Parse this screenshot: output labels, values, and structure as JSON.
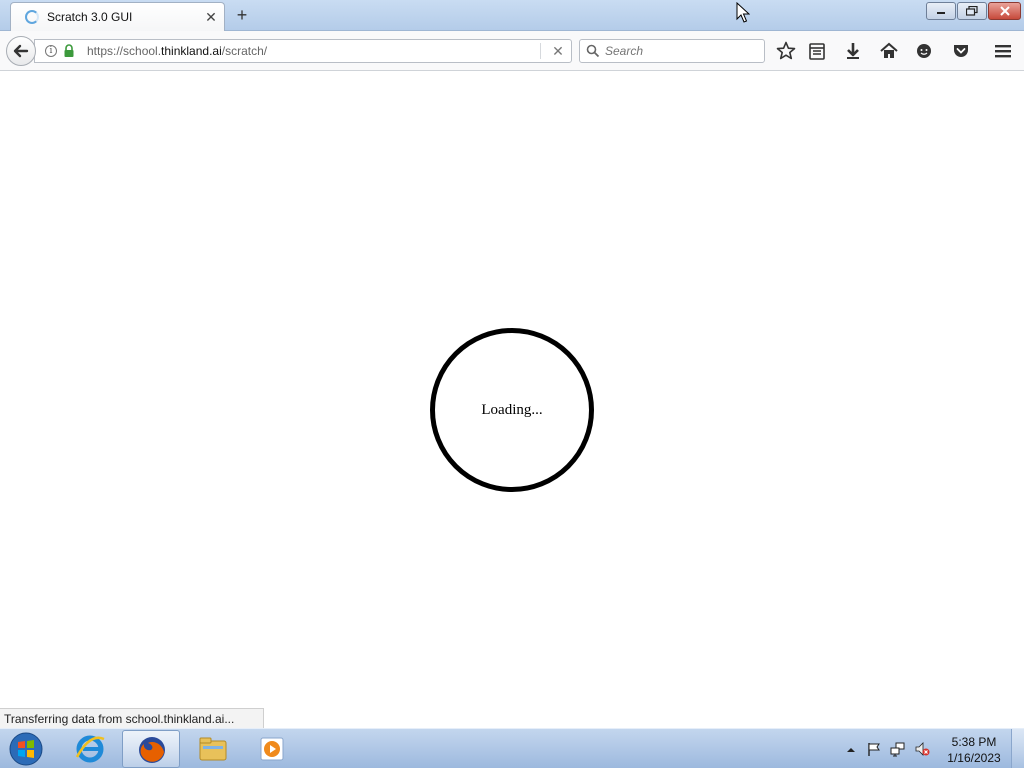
{
  "browser": {
    "tab": {
      "title": "Scratch 3.0 GUI"
    },
    "url": {
      "prefix": "https://school.",
      "host": "thinkland.ai",
      "path": "/scratch/"
    },
    "search": {
      "placeholder": "Search"
    }
  },
  "page": {
    "loading_text": "Loading..."
  },
  "status_bar": {
    "text": "Transferring data from school.thinkland.ai..."
  },
  "taskbar": {
    "items": [
      "start-icon",
      "internet-explorer-icon",
      "firefox-icon",
      "file-explorer-icon",
      "media-player-icon"
    ],
    "clock": {
      "time": "5:38 PM",
      "date": "1/16/2023"
    }
  },
  "colors": {
    "titlebar": "#b4cce9",
    "toolbar": "#f9f9fa",
    "taskbar": "#9db9de",
    "loader_ring": "#000000"
  }
}
